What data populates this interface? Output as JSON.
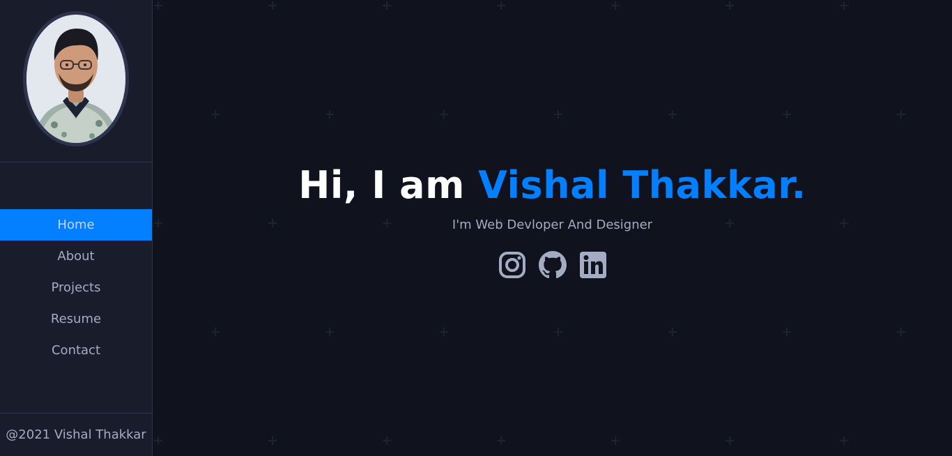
{
  "sidebar": {
    "avatar_alt": "Vishal Thakkar",
    "nav": [
      {
        "label": "Home",
        "active": true
      },
      {
        "label": "About",
        "active": false
      },
      {
        "label": "Projects",
        "active": false
      },
      {
        "label": "Resume",
        "active": false
      },
      {
        "label": "Contact",
        "active": false
      }
    ],
    "copyright": "@2021 Vishal Thakkar"
  },
  "hero": {
    "greeting": "Hi, I am ",
    "name": "Vishal Thakkar.",
    "subtitle": "I'm Web Devloper And Designer"
  },
  "socials": [
    {
      "icon": "instagram-icon"
    },
    {
      "icon": "github-icon"
    },
    {
      "icon": "linkedin-icon"
    }
  ],
  "colors": {
    "background": "#10121d",
    "sidebar": "#191d2b",
    "border": "#2e344e",
    "accent": "#037fff",
    "text": "#a4acc4",
    "heading": "#ffffff"
  }
}
